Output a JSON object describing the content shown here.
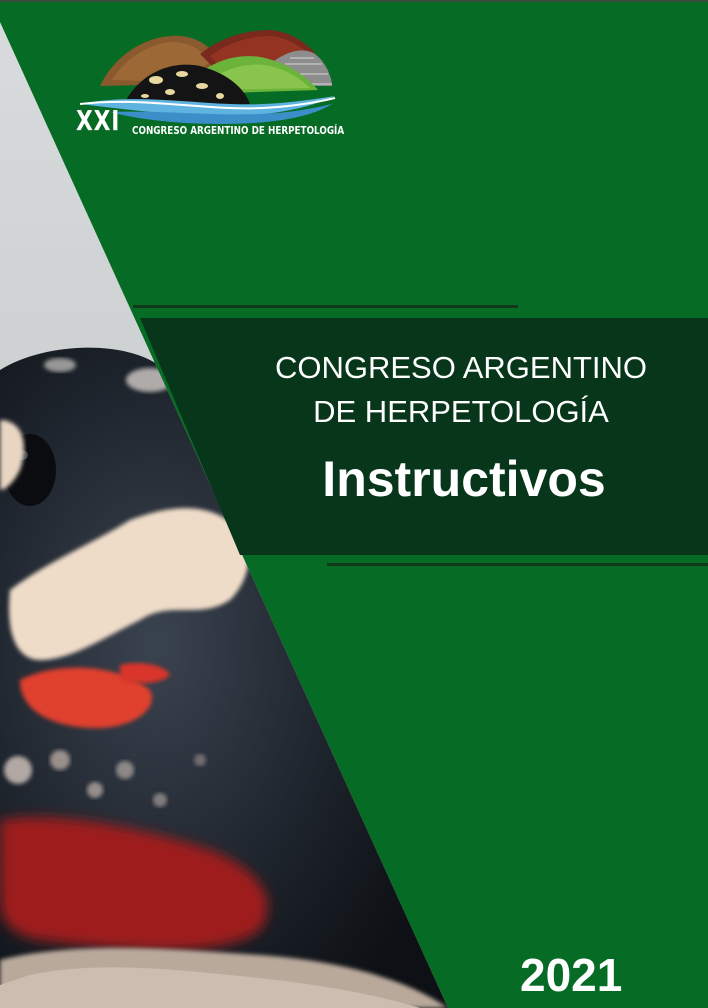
{
  "logo": {
    "numeral": "XXI",
    "subtitle": "CONGRESO ARGENTINO DE HERPETOLOGÍA"
  },
  "title": {
    "line1": "CONGRESO ARGENTINO",
    "line2": "DE HERPETOLOGÍA",
    "main": "Instructivos"
  },
  "year": "2021",
  "colors": {
    "background_green": "#066b24",
    "title_band": "#07361a",
    "divider": "#113a1c",
    "text": "#ffffff"
  }
}
